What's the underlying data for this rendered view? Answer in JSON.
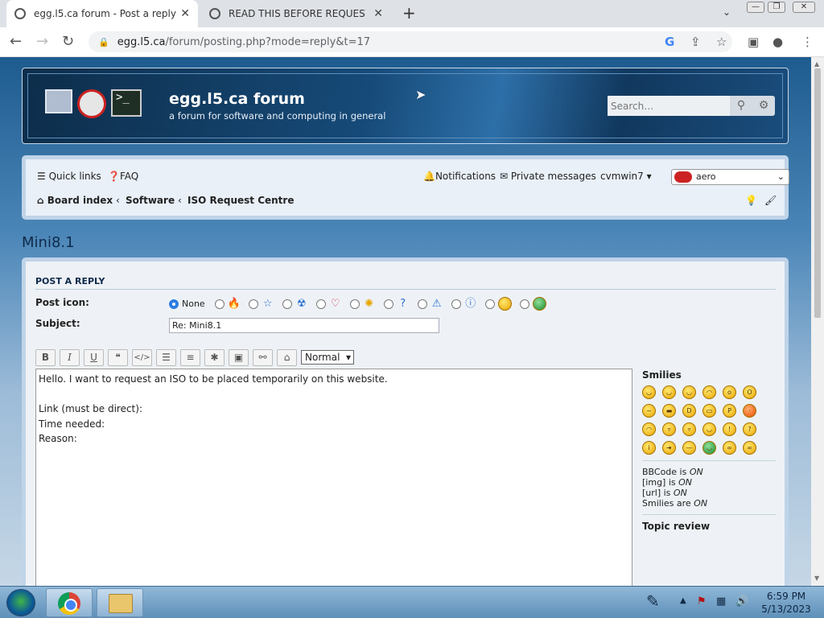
{
  "browser": {
    "tabs": [
      {
        "title": "egg.l5.ca forum - Post a reply",
        "active": true
      },
      {
        "title": "READ THIS BEFORE REQUESTING",
        "active": false
      }
    ],
    "new_tab": "+",
    "url_host": "egg.l5.ca",
    "url_path": "/forum/posting.php?mode=reply&t=17"
  },
  "header": {
    "site_title": "egg.l5.ca forum",
    "site_description": "a forum for software and computing in general",
    "search_placeholder": "Search…"
  },
  "navbar": {
    "quick_links": "Quick links",
    "faq": "FAQ",
    "notifications": "Notifications",
    "private_messages": "Private messages",
    "username": "cvmwin7",
    "style_value": "aero",
    "breadcrumbs": [
      "Board index",
      "Software",
      "ISO Request Centre"
    ]
  },
  "page": {
    "title": "Mini8.1"
  },
  "post": {
    "section_title": "POST A REPLY",
    "post_icon_label": "Post icon:",
    "post_icon_none": "None",
    "subject_label": "Subject:",
    "subject_value": "Re: Mini8.1",
    "font_size": "Normal",
    "toolbar": [
      "B",
      "I",
      "U",
      "❝",
      "</>",
      "☰",
      "≡",
      "✱",
      "▣",
      "⚯",
      "⌂"
    ],
    "message": "Hello. I want to request an ISO to be placed temporarily on this website.\n\nLink (must be direct):\nTime needed:\nReason:"
  },
  "sidebar": {
    "smilies_title": "Smilies",
    "bbcode": "BBCode is",
    "img": "[img] is",
    "url": "[url] is",
    "smilies": "Smilies are",
    "on": "ON",
    "topic_review": "Topic review"
  },
  "taskbar": {
    "time": "6:59 PM",
    "date": "5/13/2023"
  },
  "colors": {
    "header_dark": "#0d2d4a",
    "accent_blue": "#2b7de1",
    "panel_bg": "#eef2f6"
  }
}
